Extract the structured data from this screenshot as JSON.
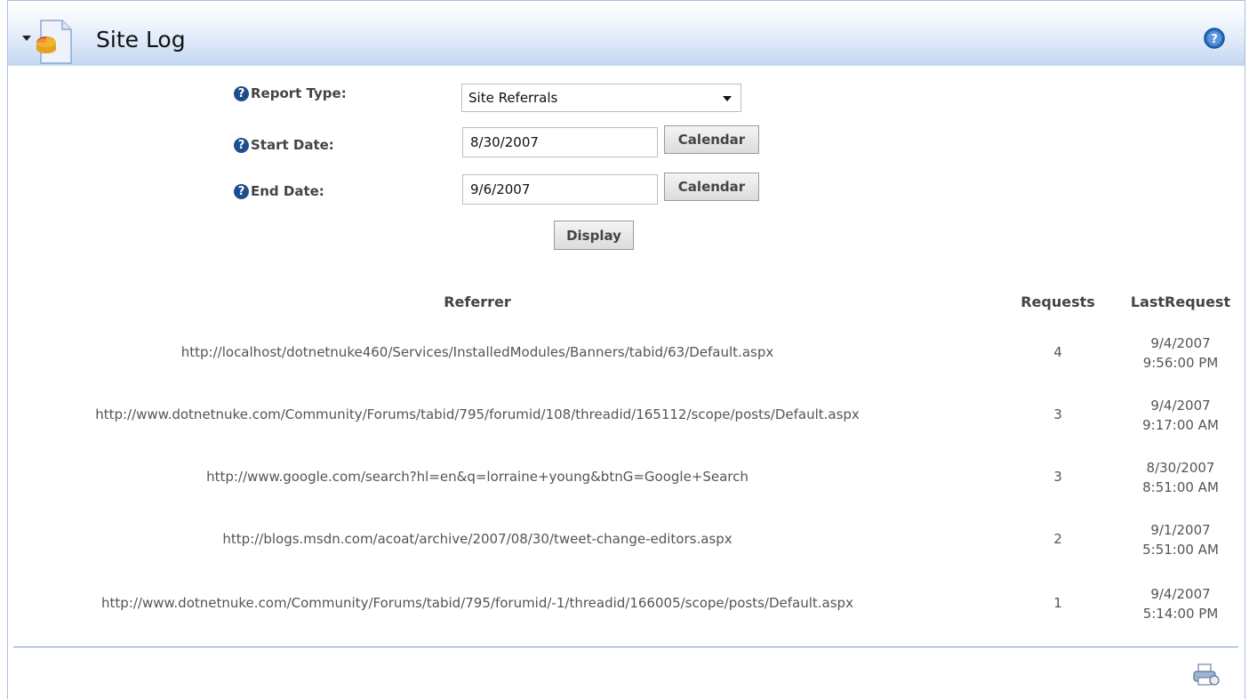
{
  "module": {
    "title": "Site Log",
    "icon": "site-log-module-icon",
    "help_icon": "help-icon"
  },
  "form": {
    "report_type_label": "Report Type:",
    "report_type_value": "Site Referrals",
    "start_date_label": "Start Date:",
    "start_date_value": "8/30/2007",
    "end_date_label": "End Date:",
    "end_date_value": "9/6/2007",
    "calendar_label": "Calendar",
    "display_label": "Display",
    "help_glyph": "?"
  },
  "table": {
    "headers": {
      "referrer": "Referrer",
      "requests": "Requests",
      "last_request": "LastRequest"
    },
    "rows": [
      {
        "referrer": "http://localhost/dotnetnuke460/Services/InstalledModules/Banners/tabid/63/Default.aspx",
        "requests": "4",
        "date": "9/4/2007",
        "time": "9:56:00 PM"
      },
      {
        "referrer": "http://www.dotnetnuke.com/Community/Forums/tabid/795/forumid/108/threadid/165112/scope/posts/Default.aspx",
        "requests": "3",
        "date": "9/4/2007",
        "time": "9:17:00 AM"
      },
      {
        "referrer": "http://www.google.com/search?hl=en&q=lorraine+young&btnG=Google+Search",
        "requests": "3",
        "date": "8/30/2007",
        "time": "8:51:00 AM"
      },
      {
        "referrer": "http://blogs.msdn.com/acoat/archive/2007/08/30/tweet-change-editors.aspx",
        "requests": "2",
        "date": "9/1/2007",
        "time": "5:51:00 AM"
      },
      {
        "referrer": "http://www.dotnetnuke.com/Community/Forums/tabid/795/forumid/-1/threadid/166005/scope/posts/Default.aspx",
        "requests": "1",
        "date": "9/4/2007",
        "time": "5:14:00 PM"
      }
    ]
  },
  "footer": {
    "icon": "print-icon"
  },
  "colors": {
    "header_blue": "#c4d6f1",
    "help_blue": "#1e4f8c",
    "divider": "#7a98c7"
  }
}
